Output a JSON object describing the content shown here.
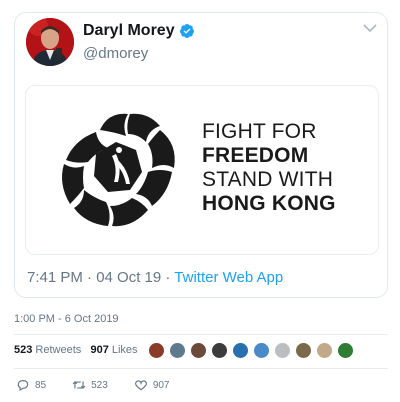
{
  "tweet": {
    "author_name": "Daryl Morey",
    "author_handle": "@dmorey",
    "verified_icon": "verified-badge-icon",
    "menu_icon": "chevron-down-icon",
    "image": {
      "logo_icon": "hong-kong-bauhinia-logo",
      "slogan": [
        "FIGHT FOR",
        "FREEDOM",
        "STAND WITH",
        "HONG KONG"
      ]
    },
    "meta_time_date": "7:41 PM · 04 Oct 19 · ",
    "meta_source": "Twitter Web App"
  },
  "timestamp": "1:00 PM - 6 Oct 2019",
  "stats": {
    "retweets_count": "523",
    "retweets_label": "Retweets",
    "likes_count": "907",
    "likes_label": "Likes"
  },
  "likers_colors": [
    "#8a3b2a",
    "#5d7a8e",
    "#6b4a3a",
    "#3c3c3c",
    "#2a6fb0",
    "#4a8ac8",
    "#b9bec3",
    "#7a6a4a",
    "#c2a98a",
    "#2e7d32"
  ],
  "actions": {
    "reply_count": "85",
    "retweet_count": "523",
    "like_count": "907"
  },
  "colors": {
    "accent": "#1da1f2",
    "muted": "#657786",
    "border": "#e1e8ed"
  }
}
